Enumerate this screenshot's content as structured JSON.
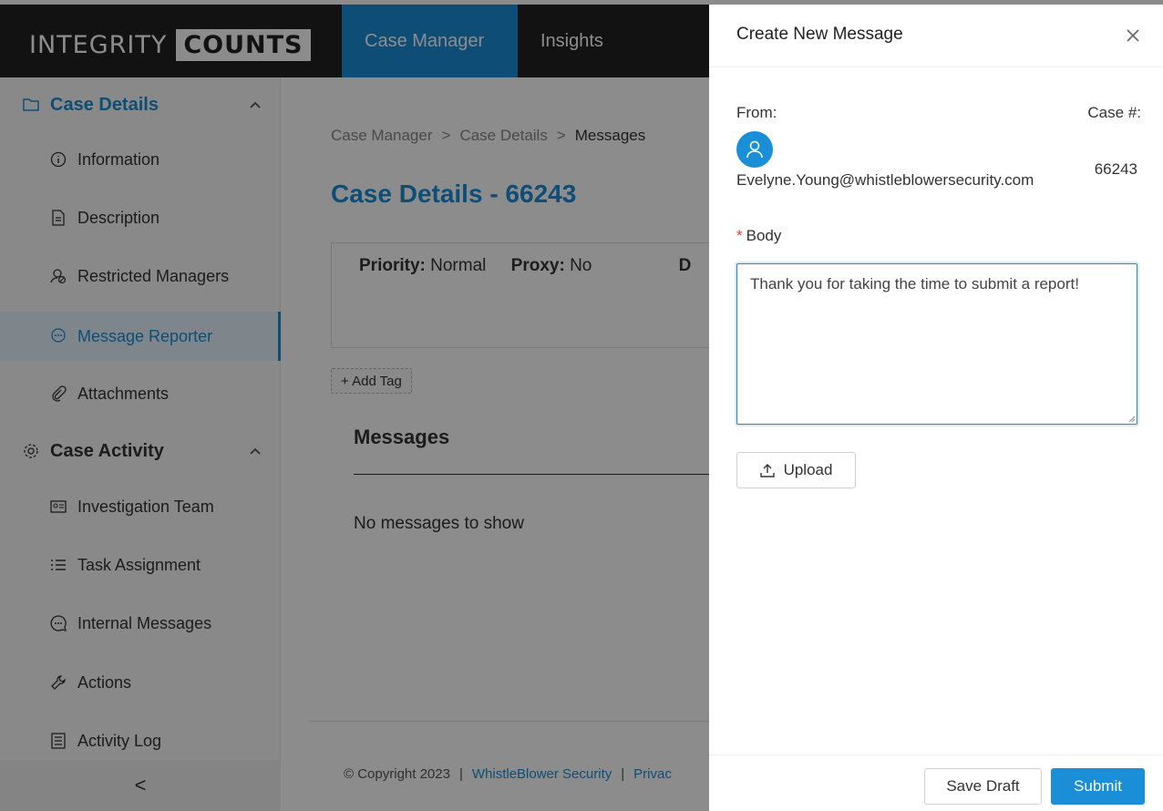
{
  "header": {
    "logo_word1": "INTEGRITY",
    "logo_word2": "COUNTS",
    "tabs": [
      {
        "label": "Case Manager",
        "active": true
      },
      {
        "label": "Insights",
        "active": false
      }
    ]
  },
  "sidebar": {
    "groups": [
      {
        "label": "Case Details",
        "icon": "folder-icon",
        "expanded": true
      },
      {
        "label": "Case Activity",
        "icon": "gear-icon",
        "expanded": true
      }
    ],
    "items": [
      {
        "label": "Information",
        "icon": "info-icon"
      },
      {
        "label": "Description",
        "icon": "document-icon"
      },
      {
        "label": "Restricted Managers",
        "icon": "restricted-user-icon"
      },
      {
        "label": "Message Reporter",
        "icon": "chat-icon",
        "active": true
      },
      {
        "label": "Attachments",
        "icon": "paperclip-icon"
      },
      {
        "label": "Investigation Team",
        "icon": "id-card-icon"
      },
      {
        "label": "Task Assignment",
        "icon": "list-icon"
      },
      {
        "label": "Internal Messages",
        "icon": "message-icon"
      },
      {
        "label": "Actions",
        "icon": "wrench-icon"
      },
      {
        "label": "Activity Log",
        "icon": "log-icon"
      }
    ],
    "collapse_glyph": "<"
  },
  "main": {
    "breadcrumb": [
      "Case Manager",
      "Case Details",
      "Messages"
    ],
    "breadcrumb_sep": ">",
    "title": "Case Details - 66243",
    "priority_label": "Priority:",
    "priority_value": "Normal",
    "proxy_label": "Proxy:",
    "proxy_value": "No",
    "truncated_field": "D",
    "add_tag": "+ Add Tag",
    "messages_heading": "Messages",
    "empty_text": "No messages to show",
    "footer": {
      "copyright": "© Copyright 2023",
      "link1": "WhistleBlower Security",
      "link2": "Privac",
      "pipe": "|"
    }
  },
  "drawer": {
    "title": "Create New Message",
    "close_glyph": "×",
    "from_label": "From:",
    "case_label": "Case #:",
    "from_email": "Evelyne.Young@whistleblowersecurity.com",
    "case_number": "66243",
    "body_required_mark": "*",
    "body_label": "Body",
    "body_value": "Thank you for taking the time to submit a report!",
    "upload_label": "Upload",
    "save_draft_label": "Save Draft",
    "submit_label": "Submit"
  },
  "colors": {
    "accent": "#1a8fd8",
    "header_bg": "#222222",
    "required": "#e53935"
  }
}
